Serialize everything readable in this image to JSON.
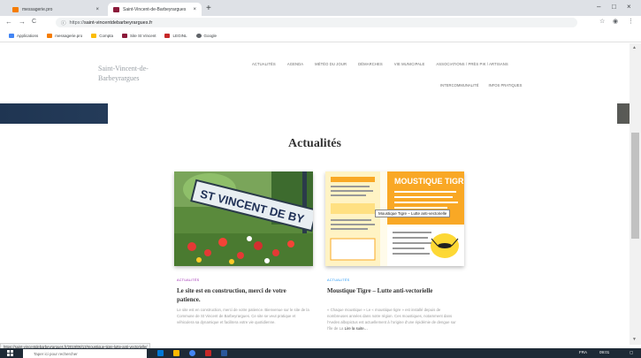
{
  "browser": {
    "tabs": [
      {
        "label": "messagerie.pro",
        "favicon_color": "#f57c00",
        "close": "×"
      },
      {
        "label": "Saint-Vincent-de-Barbeyrargues",
        "favicon_color": "#8b1a3a",
        "close": "×"
      }
    ],
    "new_tab": "+",
    "window_controls": {
      "minimize": "–",
      "maximize": "□",
      "close": "×"
    },
    "nav": {
      "back": "←",
      "forward": "→",
      "reload": "C"
    },
    "address": {
      "protocol": "https://",
      "host": "saint-vincentdebarbeyrargues.fr",
      "lock": "ⓘ"
    },
    "toolbar_icons": {
      "star": "☆",
      "account": "◉",
      "menu": "⋮"
    },
    "bookmarks": [
      {
        "label": "Applications",
        "color": "#4285f4"
      },
      {
        "label": "messagerie.pro",
        "color": "#f57c00"
      },
      {
        "label": "Compta",
        "color": "#fbbc04"
      },
      {
        "label": "Site St Vincent",
        "color": "#8b1a3a"
      },
      {
        "label": "LEGINL",
        "color": "#c62828"
      },
      {
        "label": "Google",
        "color": "#5f6368"
      }
    ]
  },
  "site": {
    "name_line1": "Saint-Vincent-de-",
    "name_line2": "Barbeyrargues",
    "nav_row1": [
      "ACTUALITÉS",
      "AGENDA",
      "MÉTÉO DU JOUR",
      "DÉMARCHES",
      "VIE MUNICIPALE",
      "ASSOCIATIONS / PRÈS PIK / ARTISANS"
    ],
    "nav_row2": [
      "INTERCOMMUNALITÉ",
      "INFOS PRATIQUES"
    ],
    "section_heading": "Actualités",
    "sign_text": "ST VINCENT DE BY",
    "posts": [
      {
        "category": "ACTUALITÉS",
        "title": "Le site est en construction, merci de votre patience.",
        "excerpt": "Le site est en construction, merci de votre patience. Bienvenue sur le site de la Commune de St Vincent de Barbeyrargues. Ce site se veut pratique et véhiculera sa dynamique et facilitera votre vie quotidienne."
      },
      {
        "category": "ACTUALITÉS",
        "title": "Moustique Tigre – Lutte anti-vectorielle",
        "excerpt": "« Chaque moustique » Le « moustique tigre » est installé depuis de nombreuses années dans notre région. Ces moustiques, notamment dans l’Aedes albopictus est actuellement à l’origine d’une épidémie de dengue sur l’île de La",
        "read_more": "Lire la suite…",
        "image_header": "MOUSTIQUE TIGRE",
        "tooltip": "Moustique Tigre – Lutte anti-vectorielle"
      }
    ]
  },
  "status_url": "https://saint-vincentdebarbeyrargues.fr/2019/06/13/moustique-tigre-lutte-anti-vectorielle/",
  "taskbar": {
    "search_placeholder": "Taper ici pour rechercher",
    "tray_lang": "FRA",
    "tray_time": "09:01",
    "icon_colors": [
      "#0078d7",
      "#ffb900",
      "#4285f4",
      "#c62828",
      "#2b579a"
    ]
  }
}
